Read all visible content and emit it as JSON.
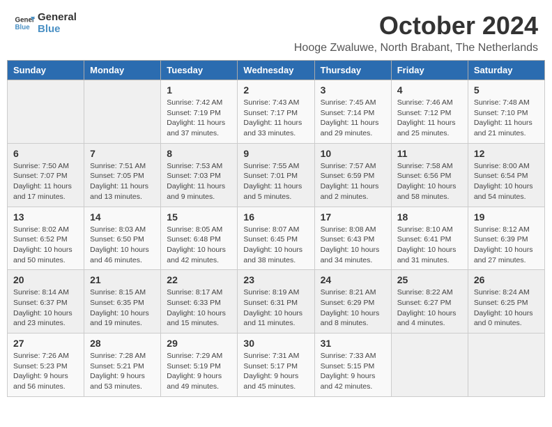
{
  "header": {
    "logo_line1": "General",
    "logo_line2": "Blue",
    "title": "October 2024",
    "subtitle": "Hooge Zwaluwe, North Brabant, The Netherlands"
  },
  "weekdays": [
    "Sunday",
    "Monday",
    "Tuesday",
    "Wednesday",
    "Thursday",
    "Friday",
    "Saturday"
  ],
  "weeks": [
    [
      {
        "day": "",
        "info": ""
      },
      {
        "day": "",
        "info": ""
      },
      {
        "day": "1",
        "info": "Sunrise: 7:42 AM\nSunset: 7:19 PM\nDaylight: 11 hours and 37 minutes."
      },
      {
        "day": "2",
        "info": "Sunrise: 7:43 AM\nSunset: 7:17 PM\nDaylight: 11 hours and 33 minutes."
      },
      {
        "day": "3",
        "info": "Sunrise: 7:45 AM\nSunset: 7:14 PM\nDaylight: 11 hours and 29 minutes."
      },
      {
        "day": "4",
        "info": "Sunrise: 7:46 AM\nSunset: 7:12 PM\nDaylight: 11 hours and 25 minutes."
      },
      {
        "day": "5",
        "info": "Sunrise: 7:48 AM\nSunset: 7:10 PM\nDaylight: 11 hours and 21 minutes."
      }
    ],
    [
      {
        "day": "6",
        "info": "Sunrise: 7:50 AM\nSunset: 7:07 PM\nDaylight: 11 hours and 17 minutes."
      },
      {
        "day": "7",
        "info": "Sunrise: 7:51 AM\nSunset: 7:05 PM\nDaylight: 11 hours and 13 minutes."
      },
      {
        "day": "8",
        "info": "Sunrise: 7:53 AM\nSunset: 7:03 PM\nDaylight: 11 hours and 9 minutes."
      },
      {
        "day": "9",
        "info": "Sunrise: 7:55 AM\nSunset: 7:01 PM\nDaylight: 11 hours and 5 minutes."
      },
      {
        "day": "10",
        "info": "Sunrise: 7:57 AM\nSunset: 6:59 PM\nDaylight: 11 hours and 2 minutes."
      },
      {
        "day": "11",
        "info": "Sunrise: 7:58 AM\nSunset: 6:56 PM\nDaylight: 10 hours and 58 minutes."
      },
      {
        "day": "12",
        "info": "Sunrise: 8:00 AM\nSunset: 6:54 PM\nDaylight: 10 hours and 54 minutes."
      }
    ],
    [
      {
        "day": "13",
        "info": "Sunrise: 8:02 AM\nSunset: 6:52 PM\nDaylight: 10 hours and 50 minutes."
      },
      {
        "day": "14",
        "info": "Sunrise: 8:03 AM\nSunset: 6:50 PM\nDaylight: 10 hours and 46 minutes."
      },
      {
        "day": "15",
        "info": "Sunrise: 8:05 AM\nSunset: 6:48 PM\nDaylight: 10 hours and 42 minutes."
      },
      {
        "day": "16",
        "info": "Sunrise: 8:07 AM\nSunset: 6:45 PM\nDaylight: 10 hours and 38 minutes."
      },
      {
        "day": "17",
        "info": "Sunrise: 8:08 AM\nSunset: 6:43 PM\nDaylight: 10 hours and 34 minutes."
      },
      {
        "day": "18",
        "info": "Sunrise: 8:10 AM\nSunset: 6:41 PM\nDaylight: 10 hours and 31 minutes."
      },
      {
        "day": "19",
        "info": "Sunrise: 8:12 AM\nSunset: 6:39 PM\nDaylight: 10 hours and 27 minutes."
      }
    ],
    [
      {
        "day": "20",
        "info": "Sunrise: 8:14 AM\nSunset: 6:37 PM\nDaylight: 10 hours and 23 minutes."
      },
      {
        "day": "21",
        "info": "Sunrise: 8:15 AM\nSunset: 6:35 PM\nDaylight: 10 hours and 19 minutes."
      },
      {
        "day": "22",
        "info": "Sunrise: 8:17 AM\nSunset: 6:33 PM\nDaylight: 10 hours and 15 minutes."
      },
      {
        "day": "23",
        "info": "Sunrise: 8:19 AM\nSunset: 6:31 PM\nDaylight: 10 hours and 11 minutes."
      },
      {
        "day": "24",
        "info": "Sunrise: 8:21 AM\nSunset: 6:29 PM\nDaylight: 10 hours and 8 minutes."
      },
      {
        "day": "25",
        "info": "Sunrise: 8:22 AM\nSunset: 6:27 PM\nDaylight: 10 hours and 4 minutes."
      },
      {
        "day": "26",
        "info": "Sunrise: 8:24 AM\nSunset: 6:25 PM\nDaylight: 10 hours and 0 minutes."
      }
    ],
    [
      {
        "day": "27",
        "info": "Sunrise: 7:26 AM\nSunset: 5:23 PM\nDaylight: 9 hours and 56 minutes."
      },
      {
        "day": "28",
        "info": "Sunrise: 7:28 AM\nSunset: 5:21 PM\nDaylight: 9 hours and 53 minutes."
      },
      {
        "day": "29",
        "info": "Sunrise: 7:29 AM\nSunset: 5:19 PM\nDaylight: 9 hours and 49 minutes."
      },
      {
        "day": "30",
        "info": "Sunrise: 7:31 AM\nSunset: 5:17 PM\nDaylight: 9 hours and 45 minutes."
      },
      {
        "day": "31",
        "info": "Sunrise: 7:33 AM\nSunset: 5:15 PM\nDaylight: 9 hours and 42 minutes."
      },
      {
        "day": "",
        "info": ""
      },
      {
        "day": "",
        "info": ""
      }
    ]
  ]
}
